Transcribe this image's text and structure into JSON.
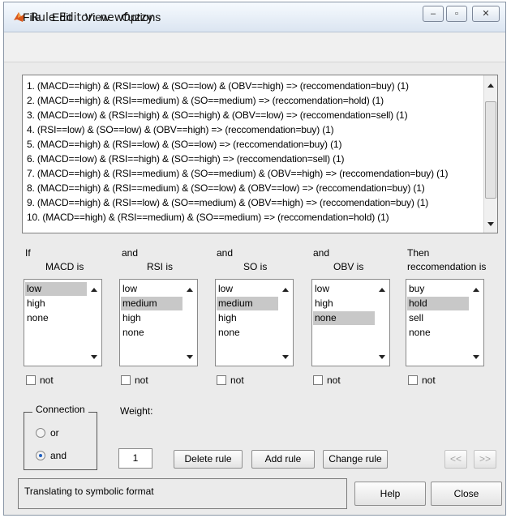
{
  "window": {
    "title": "Rule Editor: newfuzzy",
    "controls": {
      "minimize": "–",
      "maximize": "▫",
      "close": "✕"
    }
  },
  "menu": [
    "File",
    "Edit",
    "View",
    "Options"
  ],
  "rules": [
    "1. (MACD==high) & (RSI==low) & (SO==low) & (OBV==high) => (reccomendation=buy) (1)",
    "2. (MACD==high) & (RSI==medium) & (SO==medium) => (reccomendation=hold) (1)",
    "3. (MACD==low) & (RSI==high) & (SO==high) & (OBV==low) => (reccomendation=sell) (1)",
    "4. (RSI==low) & (SO==low) & (OBV==high) => (reccomendation=buy) (1)",
    "5. (MACD==high) & (RSI==low) & (SO==low) => (reccomendation=buy) (1)",
    "6. (MACD==low) & (RSI==high) & (SO==high) => (reccomendation=sell) (1)",
    "7. (MACD==high) & (RSI==medium) & (SO==medium) & (OBV==high) => (reccomendation=buy) (1)",
    "8. (MACD==high) & (RSI==medium) & (SO==low) & (OBV==low) => (reccomendation=buy) (1)",
    "9. (MACD==high) & (RSI==low) & (SO==medium) & (OBV==high) => (reccomendation=buy) (1)",
    "10. (MACD==high) & (RSI==medium) & (SO==medium) => (reccomendation=hold) (1)"
  ],
  "columns": [
    {
      "prefix": "If",
      "label": "MACD is",
      "options": [
        "low",
        "high",
        "none"
      ],
      "selected": "low",
      "not_label": "not"
    },
    {
      "prefix": "and",
      "label": "RSI is",
      "options": [
        "low",
        "medium",
        "high",
        "none"
      ],
      "selected": "medium",
      "not_label": "not"
    },
    {
      "prefix": "and",
      "label": "SO is",
      "options": [
        "low",
        "medium",
        "high",
        "none"
      ],
      "selected": "medium",
      "not_label": "not"
    },
    {
      "prefix": "and",
      "label": "OBV is",
      "options": [
        "low",
        "high",
        "none"
      ],
      "selected": "none",
      "not_label": "not"
    },
    {
      "prefix": "Then",
      "label": "reccomendation is",
      "options": [
        "buy",
        "hold",
        "sell",
        "none"
      ],
      "selected": "hold",
      "not_label": "not"
    }
  ],
  "connection": {
    "title": "Connection",
    "options": [
      "or",
      "and"
    ],
    "selected": "and"
  },
  "weight": {
    "label": "Weight:",
    "value": "1"
  },
  "buttons": {
    "delete": "Delete rule",
    "add": "Add rule",
    "change": "Change rule",
    "prev": "<<",
    "next": ">>",
    "help": "Help",
    "close": "Close"
  },
  "status": "Translating to symbolic format",
  "colors": {
    "selection": "#c8c8c8",
    "radio_accent": "#1f5fbf",
    "title_gradient_top": "#f6fafe"
  }
}
